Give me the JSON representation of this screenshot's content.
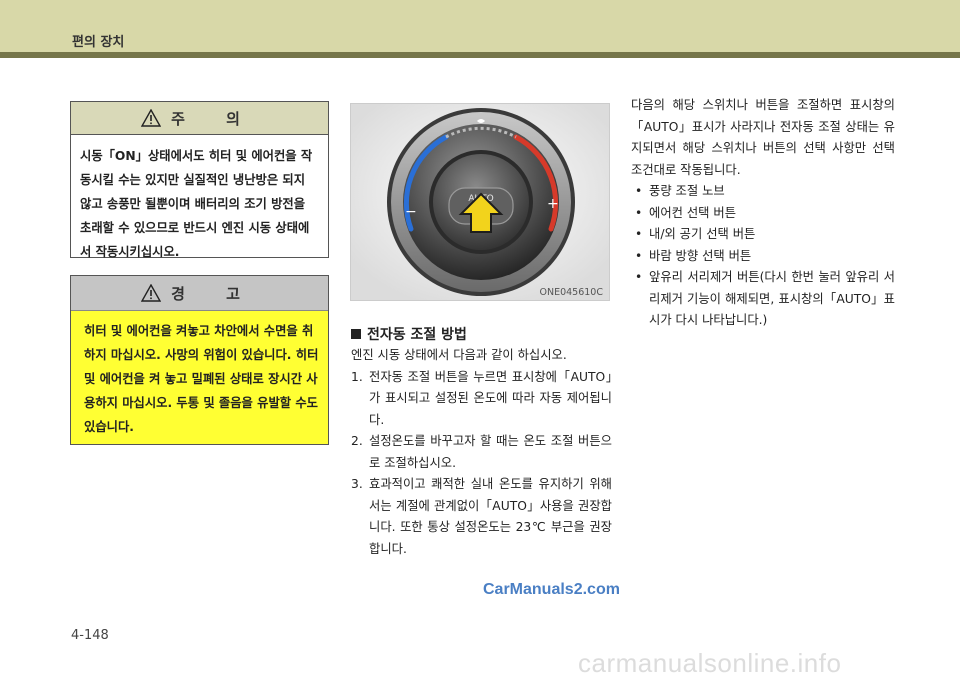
{
  "header": {
    "title": "편의 장치"
  },
  "caution": {
    "title": "주 의",
    "body": "시동「ON」상태에서도 히터 및 에어컨을 작동시킬 수는 있지만 실질적인 냉난방은 되지 않고 송풍만 될뿐이며 배터리의 조기 방전을 초래할 수 있으므로 반드시 엔진 시동 상태에서 작동시키십시오."
  },
  "warning": {
    "title": "경 고",
    "body": "히터 및 에어컨을 켜놓고 차안에서 수면을 취하지 마십시오. 사망의 위험이 있습니다. 히터 및 에어컨을 켜 놓고 밀폐된 상태로 장시간 사용하지 마십시오. 두통 및 졸음을 유발할 수도 있습니다."
  },
  "figure": {
    "code": "ONE045610C",
    "button_label": "AUTO"
  },
  "section": {
    "title": "전자동 조절 방법",
    "intro": "엔진 시동 상태에서 다음과 같이 하십시오.",
    "steps": [
      {
        "num": "1.",
        "text": "전자동 조절 버튼을 누르면 표시창에「AUTO」가 표시되고 설정된 온도에 따라 자동 제어됩니다."
      },
      {
        "num": "2.",
        "text": "설정온도를 바꾸고자 할 때는 온도 조절 버튼으로 조절하십시오."
      },
      {
        "num": "3.",
        "text": "효과적이고 쾌적한 실내 온도를 유지하기 위해서는 계절에 관계없이「AUTO」사용을 권장합니다. 또한 통상 설정온도는 23℃ 부근을 권장합니다."
      }
    ]
  },
  "right": {
    "intro": "다음의 해당 스위치나 버튼을 조절하면 표시창의「AUTO」표시가 사라지나 전자동 조절 상태는 유지되면서 해당 스위치나 버튼의 선택 사항만 선택 조건대로 작동됩니다.",
    "bullets": [
      "풍량 조절 노브",
      "에어컨 선택 버튼",
      "내/외 공기 선택 버튼",
      "바람 방향 선택 버튼",
      "앞유리 서리제거 버튼(다시 한번 눌러 앞유리 서리제거 기능이 해제되면, 표시창의「AUTO」표시가 다시 나타납니다.)"
    ],
    "bullet_symbol": "•"
  },
  "footer": {
    "watermark": "CarManuals2.com",
    "page_number": "4-148",
    "site_mark": "carmanualsonline.info"
  },
  "colors": {
    "header_band": "#d8d8a8",
    "header_rule": "#76764a",
    "warning_fill": "#ffff33",
    "caution_head": "#d9d9b8",
    "warning_head": "#c5c5c5",
    "arrow_yellow": "#f2d31c"
  }
}
